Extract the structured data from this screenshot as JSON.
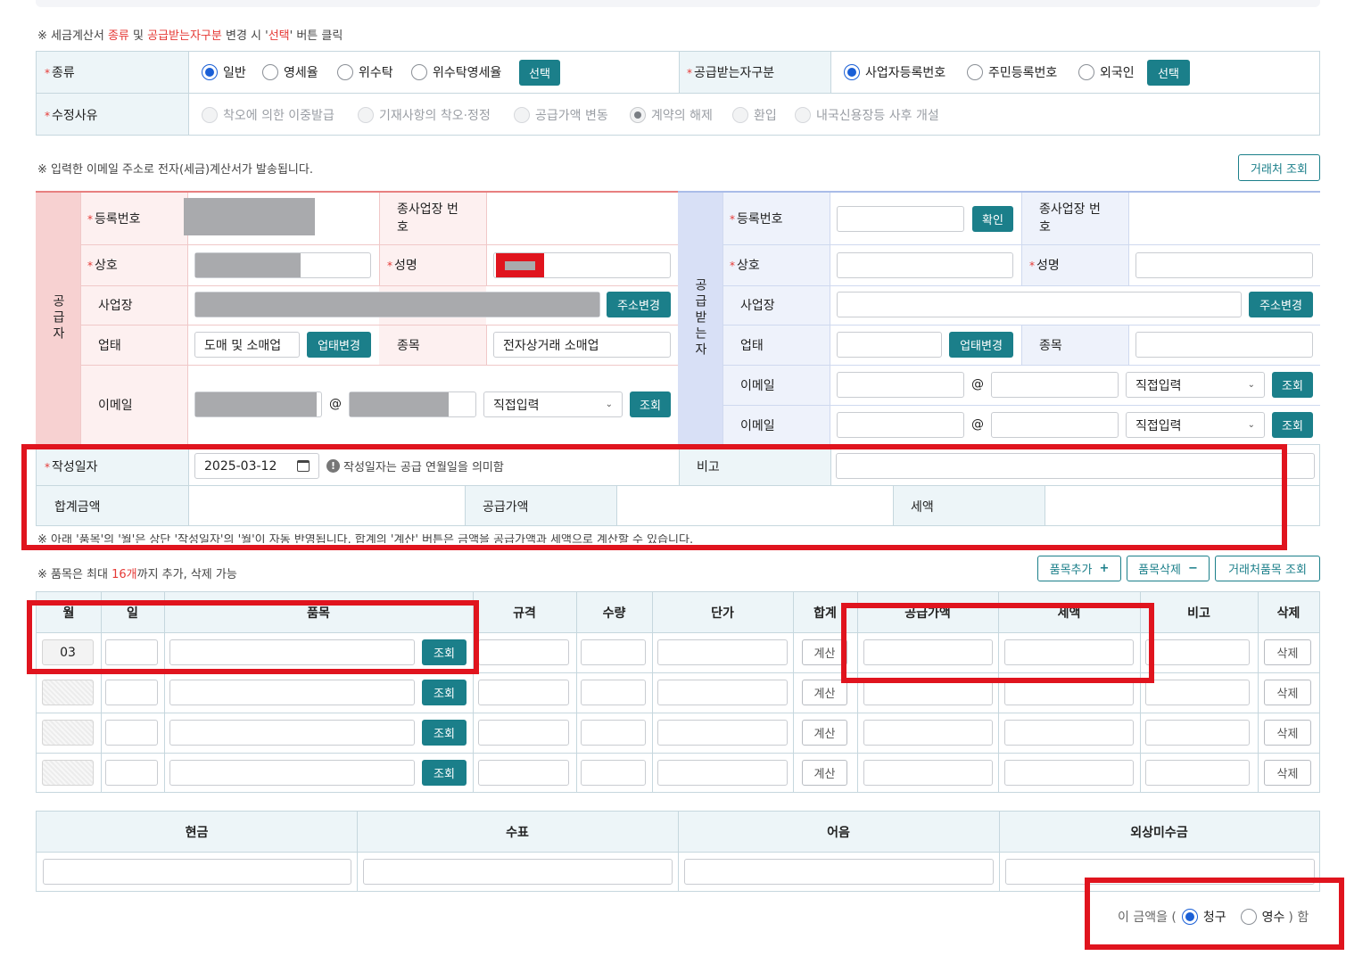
{
  "notice1": {
    "pre": "※ 세금계산서 ",
    "kind": "종류",
    "mid1": " 및 ",
    "recv": "공급받는자구분",
    "mid2": " 변경 시 '",
    "sel": "선택",
    "post": "' 버튼 클릭"
  },
  "type_row": {
    "label": "종류",
    "options": [
      "일반",
      "영세율",
      "위수탁",
      "위수탁영세율"
    ],
    "select_button": "선택",
    "recv_label": "공급받는자구분",
    "recv_options": [
      "사업자등록번호",
      "주민등록번호",
      "외국인"
    ],
    "recv_select_button": "선택"
  },
  "reason_row": {
    "label": "수정사유",
    "options": [
      "착오에 의한 이중발급",
      "기재사항의 착오·정정",
      "공급가액 변동",
      "계약의 해제",
      "환입",
      "내국신용장등 사후 개설"
    ]
  },
  "notice2": "※ 입력한 이메일 주소로 전자(세금)계산서가 발송됩니다.",
  "partner_lookup_button": "거래처 조회",
  "supplier": {
    "side_label": "공급자",
    "reg_no": "등록번호",
    "sub_biz": "종사업장 번호",
    "company": "상호",
    "name": "성명",
    "address": "사업장",
    "address_button": "주소변경",
    "biz_type": "업태",
    "biz_type_value": "도매 및 소매업",
    "biz_type_button": "업태변경",
    "item": "종목",
    "item_value": "전자상거래 소매업",
    "email": "이메일",
    "at": "@",
    "email_select": "직접입력",
    "lookup": "조회"
  },
  "receiver": {
    "side_label": "공급받는자",
    "reg_no": "등록번호",
    "confirm": "확인",
    "sub_biz": "종사업장 번호",
    "company": "상호",
    "name": "성명",
    "address": "사업장",
    "address_button": "주소변경",
    "biz_type": "업태",
    "biz_type_button": "업태변경",
    "item": "종목",
    "email1": "이메일",
    "email2": "이메일",
    "at": "@",
    "email_select": "직접입력",
    "lookup": "조회"
  },
  "date_row": {
    "label": "작성일자",
    "date": "2025-03-12",
    "hint": "작성일자는 공급 연월일을 의미함",
    "remark": "비고"
  },
  "sum_row": {
    "total": "합계금액",
    "supply": "공급가액",
    "tax": "세액"
  },
  "notice3": "※ 아래 '품목'의 '월'은 상단 '작성일자'의 '월'이 자동 반영됩니다. 합계의 '계산' 버튼은 금액을 공급가액과 세액으로 계산할 수 있습니다.",
  "notice4": {
    "pre": "※ 품목은 최대 ",
    "count": "16개",
    "post": "까지 추가, 삭제 가능"
  },
  "item_buttons": {
    "add": "품목추가",
    "add_icon": "+",
    "del": "품목삭제",
    "del_icon": "−",
    "lookup": "거래처품목 조회"
  },
  "item_table": {
    "headers": [
      "월",
      "일",
      "품목",
      "규격",
      "수량",
      "단가",
      "합계",
      "공급가액",
      "세액",
      "비고",
      "삭제"
    ],
    "first_month": "03",
    "lookup": "조회",
    "calc": "계산",
    "delete": "삭제"
  },
  "payment": {
    "headers": [
      "현금",
      "수표",
      "어음",
      "외상미수금"
    ]
  },
  "amount": {
    "pre": "이 금액을 (",
    "opt1": "청구",
    "opt2": "영수",
    "post": ") 함"
  }
}
